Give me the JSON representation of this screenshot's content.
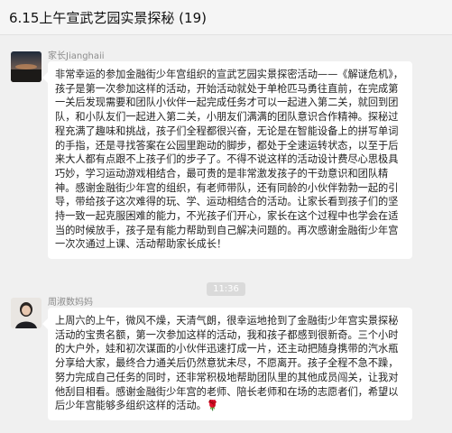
{
  "header": {
    "title": "6.15上午宣武艺园实景探秘 (19)"
  },
  "messages": [
    {
      "sender": "家长Jianghaii",
      "text": "非常幸运的参加金融街少年宫组织的宣武艺园实景探密活动——《解谜危机》，孩子是第一次参加这样的活动，开始活动就处于单枪匹马勇往直前，在完成第一关后发现需要和团队小伙伴一起完成任务才可以一起进入第二关，就回到团队，和小队友们一起进入第二关，小朋友们满满的团队意识合作精神。探秘过程充满了趣味和挑战，孩子们全程都很兴奋，无论是在智能设备上的拼写单词的手指，还是寻找答案在公园里跑动的脚步，都处于全速运转状态，以至于后来大人都有点跟不上孩子们的步子了。不得不说这样的活动设计费尽心思极具巧妙，学习运动游戏相结合，最可贵的是非常激发孩子的干劲意识和团队精神。感谢金融街少年宫的组织，有老师带队，还有同龄的小伙伴勃勃一起的引导，带给孩子这次难得的玩、学、运动相结合的活动。让家长看到孩子们的坚持一致一起克服困难的能力，不光孩子们开心，家长在这个过程中也学会在适当的时候放手，孩子是有能力帮助到自己解决问题的。再次感谢金融街少年宫一次次通过上课、活动帮助家长成长！"
    },
    {
      "sender": "周淑数妈妈",
      "text": "上周六的上午，微风不燥，天清气朗，很幸运地抢到了金融街少年宫实景探秘活动的宝贵名额，第一次参加这样的活动，我和孩子都感到很新奇。三个小时的大户外，娃和初次谋面的小伙伴迅速打成一片，还主动把随身携带的汽水瓶分享给大家，最终合力通关后仍然意犹未尽，不愿离开。孩子全程不急不躁，努力完成自己任务的同时，还非常积极地帮助团队里的其他成员闯关，让我对他刮目相看。感谢金融街少年宫的老师、陪长老师和在场的志愿者们，希望以后少年宫能够多组织这样的活动。",
      "emoji": "🌹"
    }
  ],
  "timestamp": "11:36"
}
